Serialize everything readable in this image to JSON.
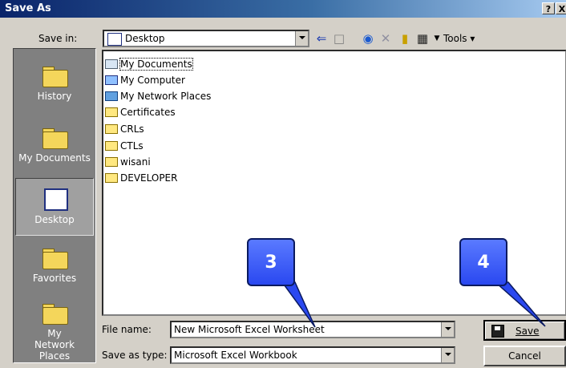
{
  "window": {
    "title": "Save As",
    "help_button": "?",
    "close_button": "X"
  },
  "toolbar": {
    "save_in_label": "Save in:",
    "save_in_value": "Desktop",
    "icons": [
      "back-icon",
      "up-folder-icon",
      "search-web-icon",
      "delete-icon",
      "new-folder-icon",
      "views-icon"
    ],
    "tools_label": "Tools"
  },
  "places": [
    {
      "label": "History",
      "selected": false
    },
    {
      "label": "My Documents",
      "selected": false
    },
    {
      "label": "Desktop",
      "selected": true
    },
    {
      "label": "Favorites",
      "selected": false
    },
    {
      "label": "My Network Places",
      "selected": false
    }
  ],
  "files": [
    {
      "name": "My Documents",
      "icon": "my-documents-icon"
    },
    {
      "name": "My Computer",
      "icon": "my-computer-icon"
    },
    {
      "name": "My Network Places",
      "icon": "network-places-icon"
    },
    {
      "name": "Certificates",
      "icon": "folder-icon"
    },
    {
      "name": "CRLs",
      "icon": "folder-icon"
    },
    {
      "name": "CTLs",
      "icon": "folder-icon"
    },
    {
      "name": "wisani",
      "icon": "folder-icon"
    },
    {
      "name": "DEVELOPER",
      "icon": "folder-shortcut-icon"
    }
  ],
  "form": {
    "file_name_label": "File name:",
    "file_name_value": "New Microsoft Excel Worksheet",
    "save_as_type_label": "Save as type:",
    "save_as_type_value": "Microsoft Excel Workbook"
  },
  "buttons": {
    "save": "Save",
    "cancel": "Cancel"
  },
  "callouts": [
    {
      "label": "3"
    },
    {
      "label": "4"
    }
  ],
  "colors": {
    "titlebar_start": "#0a246a",
    "titlebar_end": "#a6caf0",
    "callout": "#3a58f8",
    "dialog_face": "#d4d0c8"
  }
}
